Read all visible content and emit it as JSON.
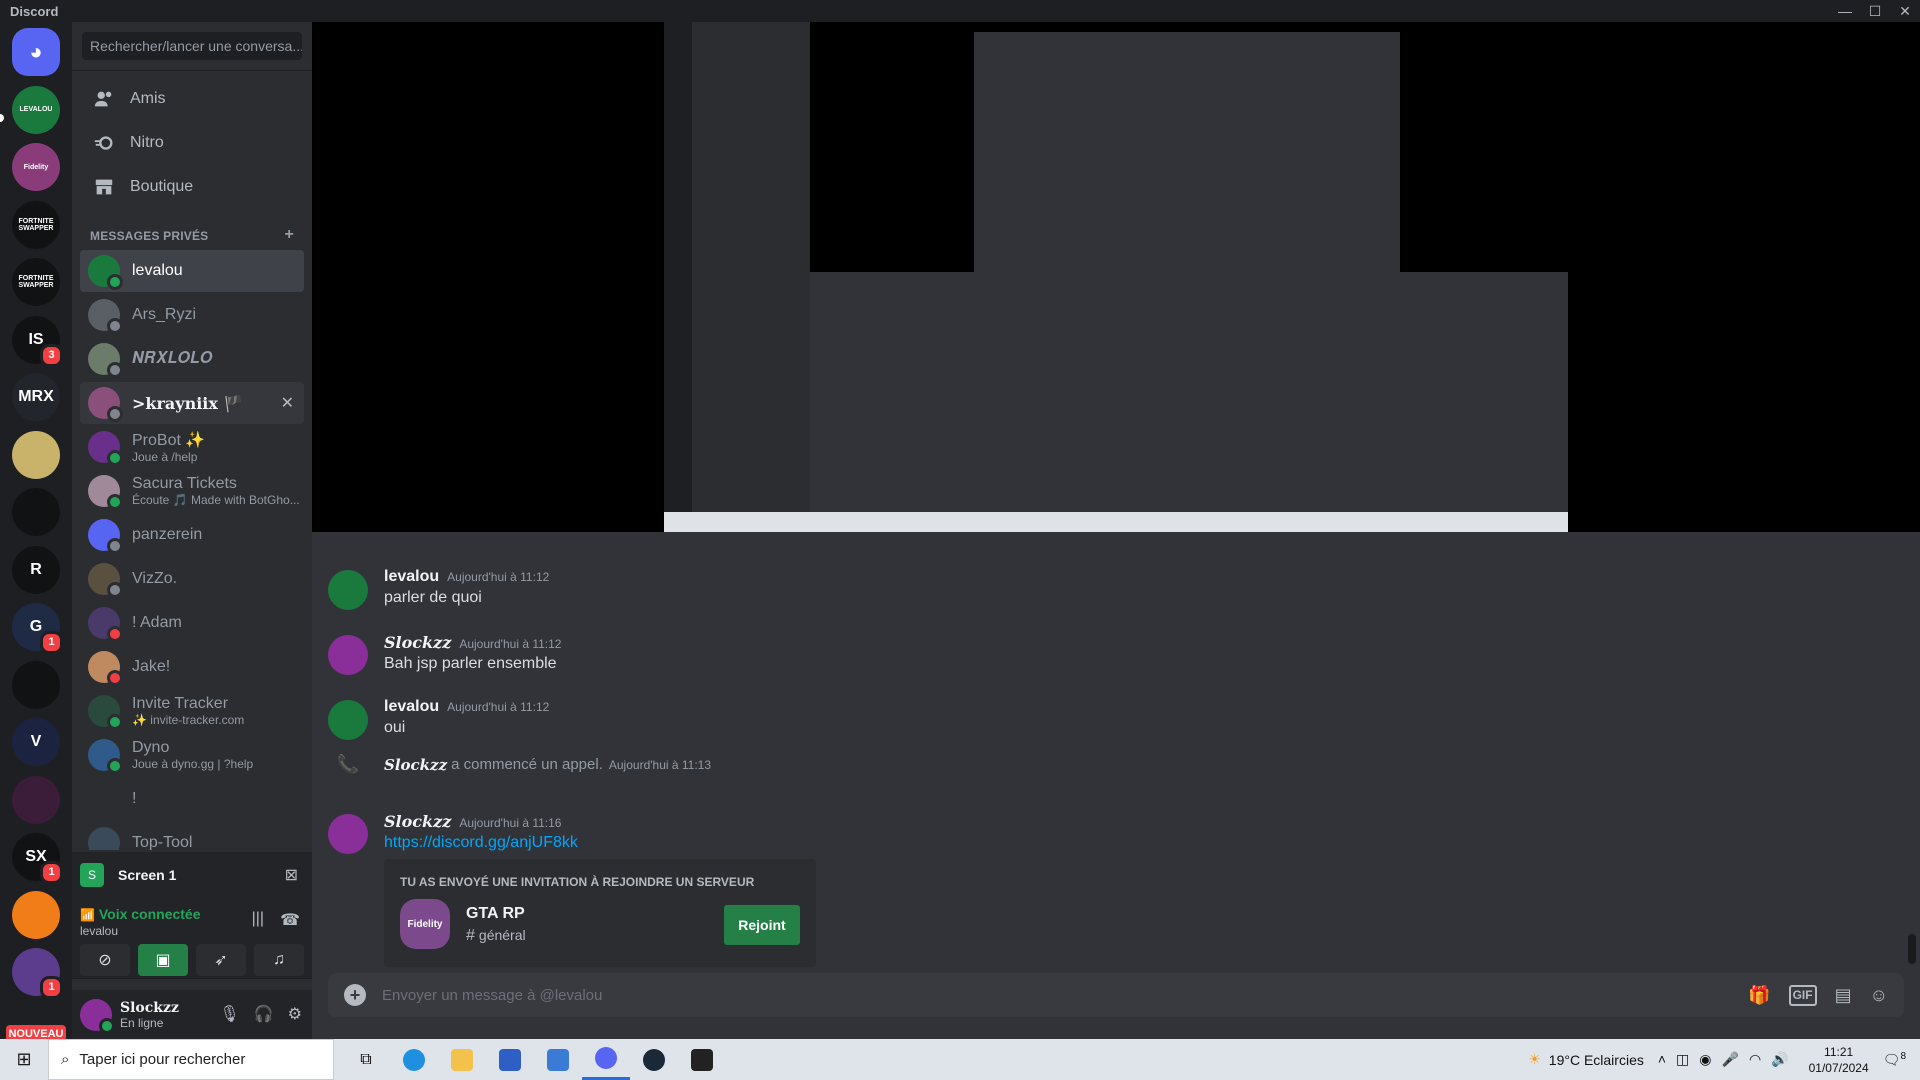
{
  "window": {
    "title": "Discord",
    "min": "—",
    "max": "☐",
    "close": "✕"
  },
  "servers": [
    {
      "label": "",
      "color": "#5865f2",
      "icon": "discord-logo-icon",
      "badge": ""
    },
    {
      "label": "LEVALOU",
      "color": "#1a7a3e",
      "icon": "",
      "badge": ""
    },
    {
      "label": "Fidelity",
      "color": "#8a3c7a",
      "icon": "",
      "badge": ""
    },
    {
      "label": "FORTNITE SWAPPER",
      "color": "#111214",
      "icon": "",
      "badge": ""
    },
    {
      "label": "FORTNITE SWAPPER",
      "color": "#111214",
      "icon": "",
      "badge": ""
    },
    {
      "label": "IS",
      "color": "#111214",
      "icon": "",
      "badge": "3"
    },
    {
      "label": "MRX",
      "color": "#22252b",
      "icon": "",
      "badge": ""
    },
    {
      "label": "",
      "color": "#c9b36a",
      "icon": "",
      "badge": ""
    },
    {
      "label": "",
      "color": "#111214",
      "icon": "",
      "badge": ""
    },
    {
      "label": "R",
      "color": "#111214",
      "icon": "",
      "badge": ""
    },
    {
      "label": "G",
      "color": "#1f2a44",
      "icon": "",
      "badge": "1"
    },
    {
      "label": "",
      "color": "#111214",
      "icon": "",
      "badge": ""
    },
    {
      "label": "V",
      "color": "#1c2340",
      "icon": "",
      "badge": ""
    },
    {
      "label": "",
      "color": "#3b1d3a",
      "icon": "",
      "badge": ""
    },
    {
      "label": "SX",
      "color": "#111214",
      "icon": "",
      "badge": "1"
    },
    {
      "label": "",
      "color": "#f07d18",
      "icon": "",
      "badge": ""
    },
    {
      "label": "",
      "color": "#5c3c8c",
      "icon": "",
      "badge": "1"
    }
  ],
  "new_badge": "NOUVEAU",
  "search": {
    "placeholder": "Rechercher/lancer une conversa..."
  },
  "nav": [
    {
      "label": "Amis",
      "icon": "friends-icon"
    },
    {
      "label": "Nitro",
      "icon": "nitro-icon"
    },
    {
      "label": "Boutique",
      "icon": "shop-icon"
    }
  ],
  "dm_header": {
    "title": "MESSAGES PRIVÉS",
    "add": "+"
  },
  "dms": [
    {
      "name": "levalou",
      "sub": "",
      "color": "#1a7a3e",
      "status": "#23a559"
    },
    {
      "name": "Ars_Ryzi",
      "sub": "",
      "color": "#5a5f66",
      "status": "#80848e"
    },
    {
      "name": "𝑵𝑹𝑿𝑳𝑶𝑳𝑶",
      "sub": "",
      "color": "#6b7d6a",
      "status": "#80848e"
    },
    {
      "name": ">krayniix 🏴",
      "sub": "",
      "color": "#8a4f7a",
      "status": "#80848e"
    },
    {
      "name": "ProBot ✨",
      "sub": "Joue à /help",
      "color": "#6a2f8a",
      "status": "#23a559"
    },
    {
      "name": "Sacura Tickets",
      "sub": "Écoute 🎵 Made with BotGho...",
      "color": "#a08a9a",
      "status": "#23a559"
    },
    {
      "name": "panzerein",
      "sub": "",
      "color": "#5865f2",
      "status": "#80848e"
    },
    {
      "name": "VizZo.",
      "sub": "",
      "color": "#5a5040",
      "status": "#80848e"
    },
    {
      "name": "! Adam",
      "sub": "",
      "color": "#4a3a6a",
      "status": "#f23f43"
    },
    {
      "name": "Jake!",
      "sub": "",
      "color": "#c08a60",
      "status": "#f23f43"
    },
    {
      "name": "Invite Tracker",
      "sub": "✨ invite-tracker.com",
      "color": "#2b4a3e",
      "status": "#23a559"
    },
    {
      "name": "Dyno",
      "sub": "Joue à dyno.gg | ?help",
      "color": "#2f5a8a",
      "status": "#23a559"
    },
    {
      "name": "!",
      "sub": "",
      "color": "#2b2d31",
      "status": ""
    },
    {
      "name": "Top-Tool",
      "sub": "",
      "color": "#3a4a5a",
      "status": ""
    }
  ],
  "voice": {
    "screen_label": "Screen 1",
    "status": "Voix connectée",
    "channel": "levalou"
  },
  "user": {
    "name": "Slockzz",
    "status": "En ligne"
  },
  "messages": [
    {
      "author": "levalou",
      "time": "Aujourd'hui à 11:12",
      "body": "parler de quoi",
      "color": "#1a7a3e",
      "fancy": false
    },
    {
      "author": "Slockzz",
      "time": "Aujourd'hui à 11:12",
      "body": "Bah jsp parler ensemble",
      "color": "#8a2f9a",
      "fancy": true
    },
    {
      "author": "levalou",
      "time": "Aujourd'hui à 11:12",
      "body": "oui",
      "color": "#1a7a3e",
      "fancy": false
    },
    {
      "author": "Slockzz",
      "time": "Aujourd'hui à 11:16",
      "body": "https://discord.gg/anjUF8kk",
      "color": "#8a2f9a",
      "fancy": true
    }
  ],
  "system_message": {
    "author": "Slockzz",
    "text": "a commencé un appel.",
    "time": "Aujourd'hui à 11:13"
  },
  "invite": {
    "header": "TU AS ENVOYÉ UNE INVITATION À REJOINDRE UN SERVEUR",
    "server": "GTA RP",
    "channel": "général",
    "button": "Rejoint"
  },
  "composer": {
    "placeholder": "Envoyer un message à @levalou"
  },
  "taskbar": {
    "search": "Taper ici pour rechercher",
    "weather": "19°C  Eclaircies",
    "time": "11:21",
    "date": "01/07/2024",
    "notif": "8"
  }
}
